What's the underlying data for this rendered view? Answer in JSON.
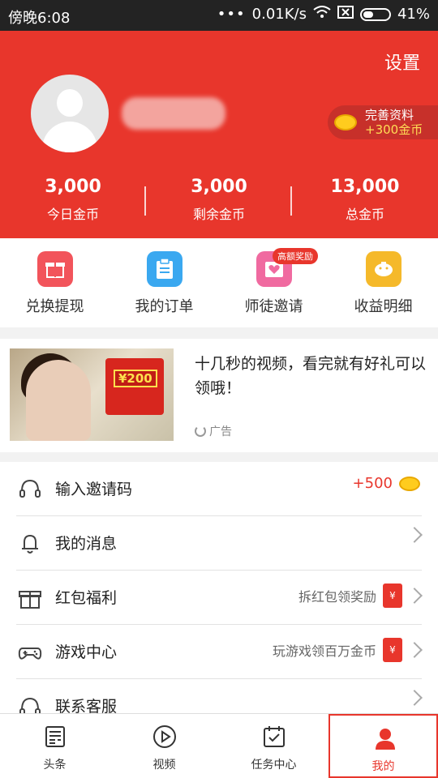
{
  "status_bar": {
    "time": "傍晚6:08",
    "network_speed": "0.01K/s",
    "battery": "41%",
    "battery_level": 0.41
  },
  "profile": {
    "settings_label": "设置",
    "complete_profile_label": "完善资料",
    "complete_profile_reward": "+300金币"
  },
  "stats": [
    {
      "value": "3,000",
      "label": "今日金币"
    },
    {
      "value": "3,000",
      "label": "剩余金币"
    },
    {
      "value": "13,000",
      "label": "总金币"
    }
  ],
  "actions": [
    {
      "label": "兑换提现",
      "icon": "gift-icon",
      "color": "#f2545b"
    },
    {
      "label": "我的订单",
      "icon": "clipboard-icon",
      "color": "#3aa8f0"
    },
    {
      "label": "师徒邀请",
      "icon": "heart-envelope-icon",
      "color": "#f06aa0",
      "badge": "高额奖励"
    },
    {
      "label": "收益明细",
      "icon": "piggy-bank-icon",
      "color": "#f5b92a"
    }
  ],
  "ad": {
    "title": "十几秒的视频，看完就有好礼可以领哦！",
    "image_badge": "¥200",
    "label": "广告"
  },
  "menu": [
    {
      "label": "输入邀请码",
      "icon": "headset-icon",
      "value": "+500"
    },
    {
      "label": "我的消息",
      "icon": "bell-icon"
    },
    {
      "label": "红包福利",
      "icon": "gift-box-icon",
      "hint": "拆红包领奖励"
    },
    {
      "label": "游戏中心",
      "icon": "gamepad-icon",
      "hint": "玩游戏领百万金币"
    },
    {
      "label": "联系客服",
      "icon": "customer-service-icon"
    }
  ],
  "tabs": [
    {
      "label": "头条",
      "icon": "news-icon"
    },
    {
      "label": "视频",
      "icon": "play-icon"
    },
    {
      "label": "任务中心",
      "icon": "calendar-check-icon"
    },
    {
      "label": "我的",
      "icon": "user-icon",
      "active": true
    }
  ],
  "colors": {
    "brand_red": "#e8362c",
    "coin_gold": "#ffcc1e"
  }
}
